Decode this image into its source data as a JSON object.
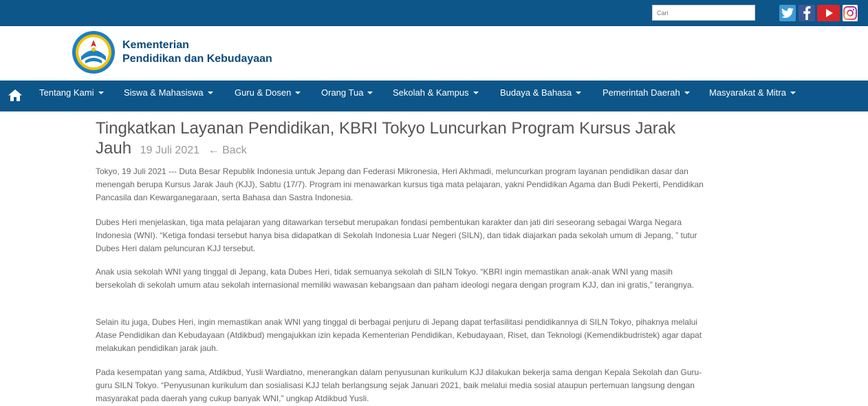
{
  "topbar": {
    "search_placeholder": "Cari",
    "social": [
      "twitter-icon",
      "facebook-icon",
      "youtube-icon",
      "instagram-icon"
    ]
  },
  "header": {
    "brand_line1": "Kementerian",
    "brand_line2": "Pendidikan dan Kebudayaan"
  },
  "nav": {
    "items": [
      {
        "label": "Tentang Kami"
      },
      {
        "label": "Siswa & Mahasiswa"
      },
      {
        "label": "Guru & Dosen"
      },
      {
        "label": "Orang Tua"
      },
      {
        "label": "Sekolah & Kampus"
      },
      {
        "label": "Budaya & Bahasa"
      },
      {
        "label": "Pemerintah Daerah"
      },
      {
        "label": "Masyarakat & Mitra"
      }
    ]
  },
  "article": {
    "title": "Tingkatkan Layanan Pendidikan, KBRI Tokyo Luncurkan Program Kursus Jarak Jauh",
    "date": "19 Juli 2021",
    "back": "← Back",
    "paragraphs": [
      "Tokyo, 19 Juli 2021 --- Duta Besar Republik Indonesia untuk Jepang dan Federasi Mikronesia, Heri Akhmadi, meluncurkan program layanan pendidikan dasar dan menengah berupa Kursus Jarak Jauh (KJJ), Sabtu (17/7). Program ini menawarkan kursus tiga mata pelajaran, yakni Pendidikan Agama dan Budi Pekerti, Pendidikan Pancasila dan Kewarganegaraan, serta Bahasa dan Sastra Indonesia.",
      "Dubes Heri menjelaskan, tiga mata pelajaran yang ditawarkan tersebut merupakan fondasi pembentukan karakter dan jati diri seseorang sebagai Warga Negara Indonesia (WNI). “Ketiga fondasi tersebut hanya bisa didapatkan di Sekolah Indonesia Luar Negeri (SILN), dan tidak diajarkan pada sekolah umum di Jepang, ” tutur Dubes Heri dalam peluncuran KJJ tersebut.",
      "Anak usia sekolah WNI yang tinggal di Jepang, kata Dubes Heri, tidak semuanya sekolah di SILN Tokyo. “KBRI ingin memastikan anak-anak WNI yang masih bersekolah di sekolah umum atau sekolah internasional memiliki wawasan kebangsaan dan paham ideologi negara dengan program KJJ, dan ini gratis,” terangnya.",
      "Selain itu juga, Dubes Heri, ingin memastikan anak WNI yang tinggal di berbagai penjuru di Jepang dapat terfasilitasi pendidikannya di SILN Tokyo, pihaknya melalui Atase Pendidikan dan Kebudayaan (Atdikbud) mengajukkan izin kepada Kementerian Pendidikan, Kebudayaan, Riset, dan Teknologi (Kemendikbudristek) agar dapat melakukan pendidikan jarak jauh.",
      "Pada kesempatan yang sama, Atdikbud, Yusli Wardiatno, menerangkan dalam penyusunan kurikulum KJJ dilakukan bekerja sama dengan Kepala Sekolah dan Guru-guru SILN Tokyo. “Penyusunan kurikulum dan sosialisasi KJJ telah berlangsung sejak Januari 2021, baik melalui media sosial ataupun pertemuan langsung dengan masyarakat pada daerah yang cukup banyak WNI,” ungkap Atdikbud Yusli."
    ]
  }
}
